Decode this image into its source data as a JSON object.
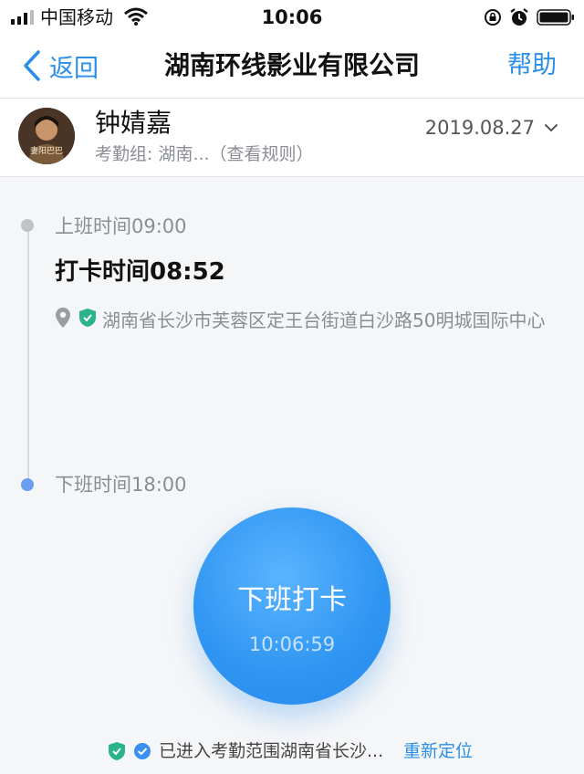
{
  "status_bar": {
    "carrier": "中国移动",
    "time": "10:06"
  },
  "nav": {
    "back_label": "返回",
    "title": "湖南环线影业有限公司",
    "help_label": "帮助"
  },
  "profile": {
    "avatar_caption": "妻阳巴巴",
    "name": "钟婧嘉",
    "group_text": "考勤组: 湖南...（查看规则）",
    "date": "2019.08.27"
  },
  "timeline": {
    "on_duty_label": "上班时间09:00",
    "punch_time": "打卡时间08:52",
    "address": "湖南省长沙市芙蓉区定王台街道白沙路50明城国际中心",
    "off_duty_label": "下班时间18:00"
  },
  "punch_button": {
    "label": "下班打卡",
    "clock": "10:06:59"
  },
  "footer": {
    "range_text": "已进入考勤范围湖南省长沙...",
    "relocate_label": "重新定位"
  },
  "colors": {
    "accent": "#2b8fe9",
    "button": "#2f95f2",
    "badge_green": "#2bb38a"
  },
  "icons": [
    "signal-icon",
    "wifi-icon",
    "lock-rotation-icon",
    "alarm-icon",
    "battery-icon",
    "back-chevron-icon",
    "chevron-down-icon",
    "location-pin-icon",
    "shield-check-icon",
    "check-circle-icon"
  ]
}
